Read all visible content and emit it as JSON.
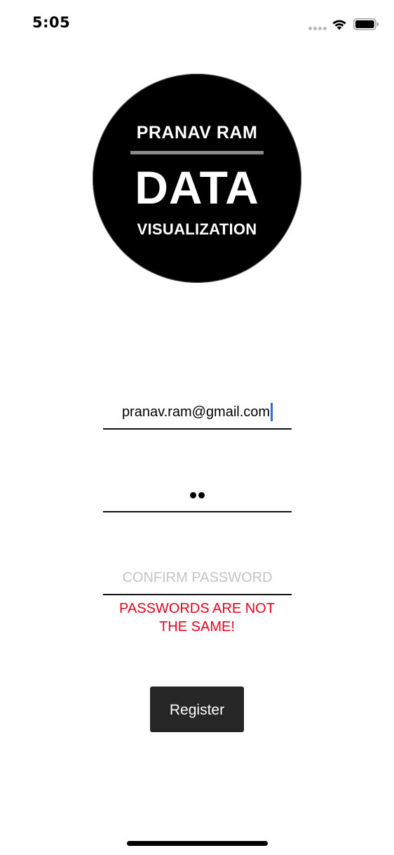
{
  "status_bar": {
    "time": "5:05",
    "signal_icon": "cellular-dots-icon",
    "wifi_icon": "wifi-icon",
    "battery_icon": "battery-icon"
  },
  "logo": {
    "top_text": "PRANAV RAM",
    "main_text": "DATA",
    "bottom_text": "VISUALIZATION"
  },
  "form": {
    "email_value": "pranav.ram@gmail.com",
    "password_masked_count": 2,
    "confirm_placeholder": "CONFIRM PASSWORD",
    "error_line1": "PASSWORDS ARE NOT",
    "error_line2": "THE SAME!",
    "register_label": "Register"
  },
  "colors": {
    "error": "#e8001c",
    "caret": "#3866e8",
    "button_bg": "#262626"
  }
}
